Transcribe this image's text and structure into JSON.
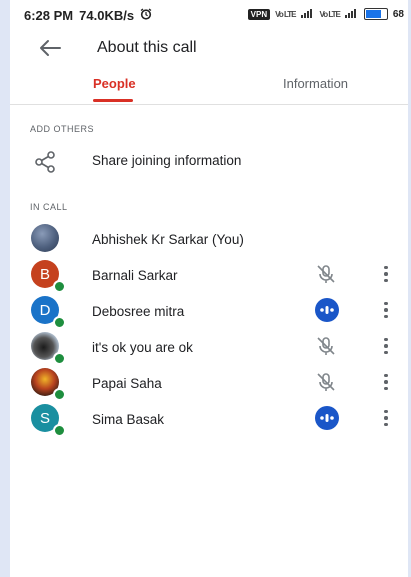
{
  "status_bar": {
    "time": "6:28 PM",
    "speed": "74.0KB/s",
    "vpn": "VPN",
    "lte1": "Vo LTE",
    "lte2": "Vo LTE",
    "battery": "68",
    "battery_level": 0.68
  },
  "header": {
    "title": "About this call",
    "back_icon": "arrow-left-icon"
  },
  "tabs": [
    {
      "label": "People",
      "active": true
    },
    {
      "label": "Information",
      "active": false
    }
  ],
  "sections": {
    "add_others": {
      "label": "ADD OTHERS",
      "share_label": "Share joining information",
      "share_icon": "share-icon"
    },
    "in_call": {
      "label": "IN CALL",
      "participants": [
        {
          "name": "Abhishek Kr Sarkar (You)",
          "initial": "",
          "avatar_color": "#4e607e",
          "mic": "none"
        },
        {
          "name": "Barnali Sarkar",
          "initial": "B",
          "avatar_color": "#c5411e",
          "mic": "muted"
        },
        {
          "name": "Debosree mitra",
          "initial": "D",
          "avatar_color": "#1a73c8",
          "mic": "speaking"
        },
        {
          "name": "it's ok you are ok",
          "initial": "",
          "avatar_color": "#a9b7c6",
          "mic": "muted"
        },
        {
          "name": "Papai Saha",
          "initial": "",
          "avatar_color": "#b7411e",
          "mic": "muted"
        },
        {
          "name": "Sima Basak",
          "initial": "S",
          "avatar_color": "#1a8fa0",
          "mic": "speaking"
        }
      ]
    }
  },
  "colors": {
    "accent_red": "#d93025",
    "speaking_blue": "#1a56c8",
    "presence_green": "#1e8e3e"
  }
}
